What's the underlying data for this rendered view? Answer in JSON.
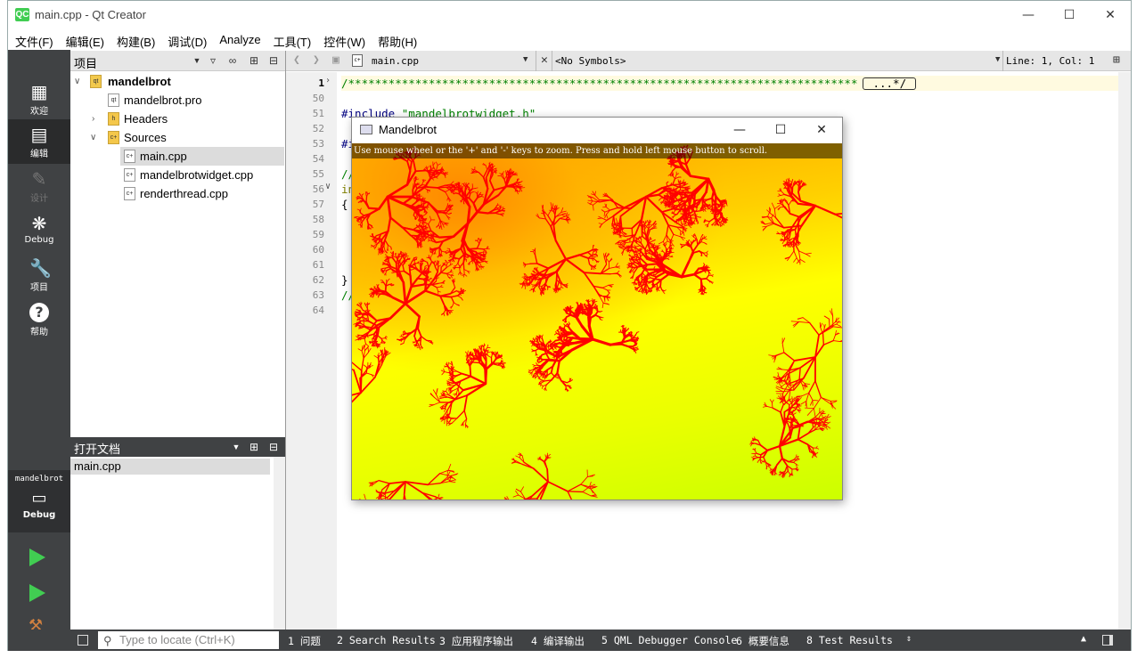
{
  "window": {
    "title": "main.cpp - Qt Creator",
    "logo": "QC"
  },
  "menu": [
    "文件(F)",
    "编辑(E)",
    "构建(B)",
    "调试(D)",
    "Analyze",
    "工具(T)",
    "控件(W)",
    "帮助(H)"
  ],
  "modes": {
    "welcome": "欢迎",
    "edit": "编辑",
    "design": "设计",
    "debug": "Debug",
    "projects": "项目",
    "help": "帮助",
    "kit_project": "mandelbrot",
    "kit_build": "Debug"
  },
  "project_panel": {
    "title": "项目",
    "root": "mandelbrot",
    "items": [
      {
        "label": "mandelbrot.pro",
        "icon": "pro-file-icon"
      },
      {
        "label": "Headers",
        "icon": "folder-icon"
      },
      {
        "label": "Sources",
        "icon": "folder-icon"
      },
      {
        "label": "main.cpp",
        "icon": "cpp-file-icon"
      },
      {
        "label": "mandelbrotwidget.cpp",
        "icon": "cpp-file-icon"
      },
      {
        "label": "renderthread.cpp",
        "icon": "cpp-file-icon"
      }
    ]
  },
  "open_docs": {
    "title": "打开文档",
    "items": [
      "main.cpp"
    ]
  },
  "editor": {
    "file": "main.cpp",
    "symbols": "<No Symbols>",
    "position": "Line: 1, Col: 1",
    "line_numbers": [
      "1",
      "50",
      "51",
      "52",
      "53",
      "54",
      "55",
      "56",
      "57",
      "58",
      "59",
      "60",
      "61",
      "62",
      "63",
      "64"
    ],
    "lines": {
      "l1": "/****************************************************************************",
      "l1_fold": "...*/",
      "l51a": "#include ",
      "l51b": "\"mandelbrotwidget.h\"",
      "l53": "#i",
      "l55": "//",
      "l56": "in",
      "l57": "{",
      "l62": "}",
      "l63": "//"
    }
  },
  "mandelbrot": {
    "title": "Mandelbrot",
    "hint": "Use mouse wheel or the '+' and '-' keys to zoom. Press and hold left mouse button to scroll."
  },
  "statusbar": {
    "locate_placeholder": "Type to locate (Ctrl+K)",
    "tabs": [
      "1  问题",
      "2  Search Results",
      "3  应用程序输出",
      "4  编译输出",
      "5  QML Debugger Console",
      "6  概要信息",
      "8  Test Results"
    ]
  },
  "colors": {
    "sidebar": "#404244",
    "accent": "#41cd52",
    "fractal_red": "#ff0000",
    "fractal_yellow": "#ffff00"
  }
}
